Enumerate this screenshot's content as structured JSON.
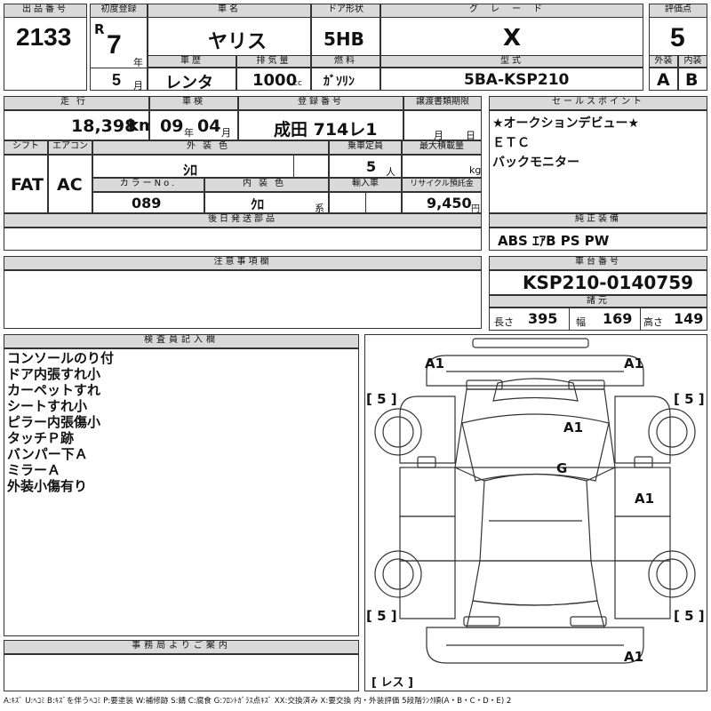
{
  "headers": {
    "lot": "出品番号",
    "first_reg": "初度登録",
    "car_name": "車名",
    "door": "ドア形状",
    "grade": "グレード",
    "score": "評価点",
    "history": "車歴",
    "displacement": "排気量",
    "fuel": "燃料",
    "model": "型式",
    "exterior": "外装",
    "interior": "内装",
    "mileage": "走行",
    "inspection": "車検",
    "reg_no": "登録番号",
    "transfer_doc": "譲渡書類期限",
    "sales_point": "セールスポイント",
    "shift": "シフト",
    "aircon": "エアコン",
    "ext_color": "外装色",
    "capacity": "乗車定員",
    "max_load": "最大積載量",
    "color_no": "カラーNo.",
    "int_color": "内装色",
    "import": "輸入車",
    "recycle": "リサイクル預託金",
    "later_parts": "後日発送部品",
    "genuine_equip": "純正装備",
    "notes": "注意事項欄",
    "chassis_no": "車台番号",
    "dimensions": "諸元",
    "inspector": "検査員記入欄",
    "office": "事務局よりご案内"
  },
  "vehicle": {
    "lot_no": "2133",
    "era": "R",
    "year": "7",
    "year_unit": "年",
    "month": "5",
    "month_unit": "月",
    "name": "ヤリス",
    "door": "5HB",
    "grade": "X",
    "score": "5",
    "history": "レンタ",
    "displacement": "1000",
    "displacement_unit": "cc",
    "fuel": "ｶﾞｿﾘﾝ",
    "model": "5BA-KSP210",
    "exterior_grade": "A",
    "interior_grade": "B",
    "mileage": "18,398",
    "mileage_unit": "km",
    "inspection_year": "09",
    "inspection_year_unit": "年",
    "inspection_month": "04",
    "inspection_month_unit": "月",
    "reg_no": "成田 714レ1",
    "transfer_month_unit": "月",
    "transfer_day_unit": "日",
    "shift": "FAT",
    "aircon": "AC",
    "ext_color": "ｼﾛ",
    "capacity": "5",
    "capacity_unit": "人",
    "max_load_unit": "kg",
    "color_no": "089",
    "int_color": "ｸﾛ",
    "int_color_unit": "系",
    "recycle": "9,450",
    "recycle_unit": "円",
    "chassis_no": "KSP210-0140759",
    "length_label": "長さ",
    "length": "395",
    "width_label": "幅",
    "width": "169",
    "height_label": "高さ",
    "height": "149"
  },
  "sales_points": [
    "★オークションデビュー★",
    "ＥＴＣ",
    "バックモニター"
  ],
  "genuine_equipment": "ABS ｴｱB PS PW",
  "inspector_notes": [
    "コンソールのり付",
    "ドア内張すれ小",
    "カーペットすれ",
    "シートすれ小",
    "ピラー内張傷小",
    "タッチＰ跡",
    "バンパー下Ａ",
    "ミラーＡ",
    "外装小傷有り"
  ],
  "diagram_marks": {
    "front_left": "A1",
    "front_right": "A1",
    "hood": "A1",
    "windshield": "G",
    "right_door": "A1",
    "rear_bumper": "A1",
    "tire_fl": "[ 5 ]",
    "tire_fr": "[ 5 ]",
    "tire_rl": "[ 5 ]",
    "tire_rr": "[ 5 ]",
    "spare": "[ レス ]"
  },
  "legend": "A:ｷｽﾞ U:ﾍｺﾐ B:ｷｽﾞを伴うﾍｺﾐ P:要塗装 W:補修跡 S:錆 C:腐食 G:ﾌﾛﾝﾄｶﾞﾗｽ点ｷｽﾞ XX:交換済み X:要交換 内・外装評価 5段階ﾗﾝｸ順(A・B・C・D・E) 2"
}
